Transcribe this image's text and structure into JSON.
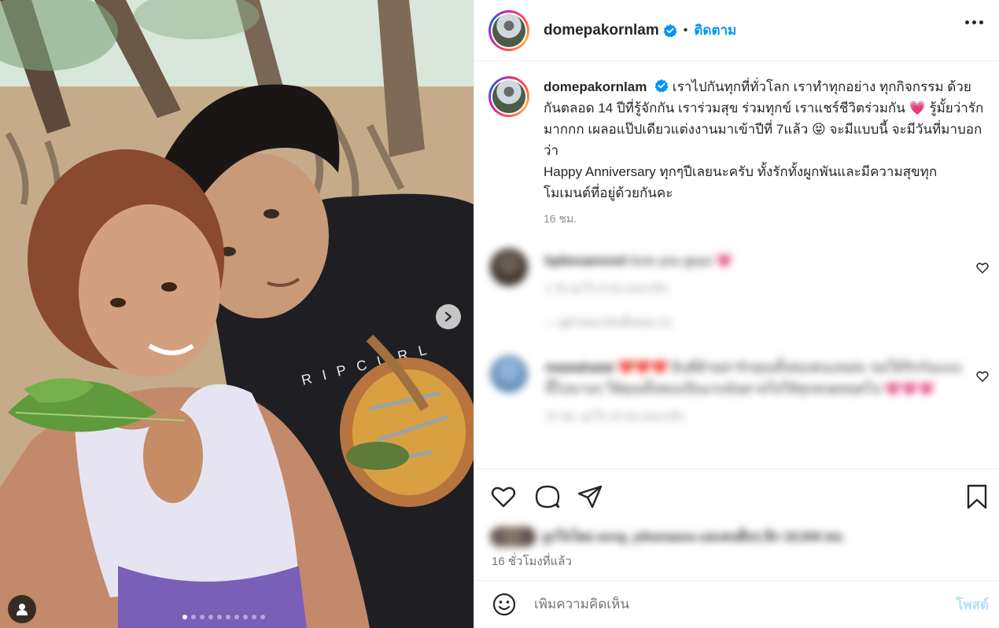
{
  "post": {
    "carousel_total": 10,
    "carousel_index": 1,
    "next_icon": "chevron-right-icon",
    "tag_icon": "user-tag-icon"
  },
  "header": {
    "username": "domepakornlam",
    "separator": "•",
    "follow_label": "ติดตาม",
    "more_icon": "more-options-icon"
  },
  "caption": {
    "username": "domepakornlam",
    "text": "เราไปกันทุกที่ทั่วโลก เราทำทุกอย่าง ทุกกิจกรรม ด้วยกันตลอด 14 ปีที่รู้จักกัน เราร่วมสุข ร่วมทุกข์ เราแชร์ชีวิตร่วมกัน 💗 รู้มั้ยว่ารักมากกก เผลอแป๊ปเดียวแต่งงานมาเข้าปีที่ 7แล้ว 😝 จะมีแบบนี้ จะมีวันที่มาบอกว่า",
    "text2": "Happy Anniversary ทุกๆปีเลยนะครับ ทั้งรักทั้งผูกพันและมีความสุขทุกโมเมนต์ที่อยู่ด้วยกันคะ",
    "time": "16 ชม."
  },
  "comments": [
    {
      "username": "kpbeuanovel",
      "text": "love you guys 💗",
      "meta": "1 วัน   ถูกใจ 6 คน   ตอบกลับ",
      "replies": "—   ดูคำตอบกลับทั้งหมด (1)"
    },
    {
      "username": "mawahatat",
      "text": "❤️❤️❤️ ยินดีด้วยค่ารักคุณทั้งสองคนเลยค่ะ ขอให้รักกันแบบนี้ไปนานๆ ให้คุณทั้งสองเป็นแรงบันดาลใจให้ทุกคนตลอดไป 💗💗💗",
      "meta": "13 ชม.   ถูกใจ 24 คน   ตอบกลับ"
    }
  ],
  "actions": {
    "like_icon": "heart-icon",
    "comment_icon": "comment-icon",
    "share_icon": "share-icon",
    "save_icon": "bookmark-icon"
  },
  "likes": {
    "text": "ถูกใจโดย aong_pikanaaoa และคนอื่นๆ อีก 18,500 คน"
  },
  "posted_time": "16 ชั่วโมงที่แล้ว",
  "add_comment": {
    "emoji_icon": "emoji-icon",
    "placeholder": "เพิ่มความคิดเห็น",
    "post_label": "โพสต์"
  },
  "colors": {
    "accent": "#0095f6",
    "post_disabled": "#b2dffc",
    "like_red": "#ed4956"
  }
}
